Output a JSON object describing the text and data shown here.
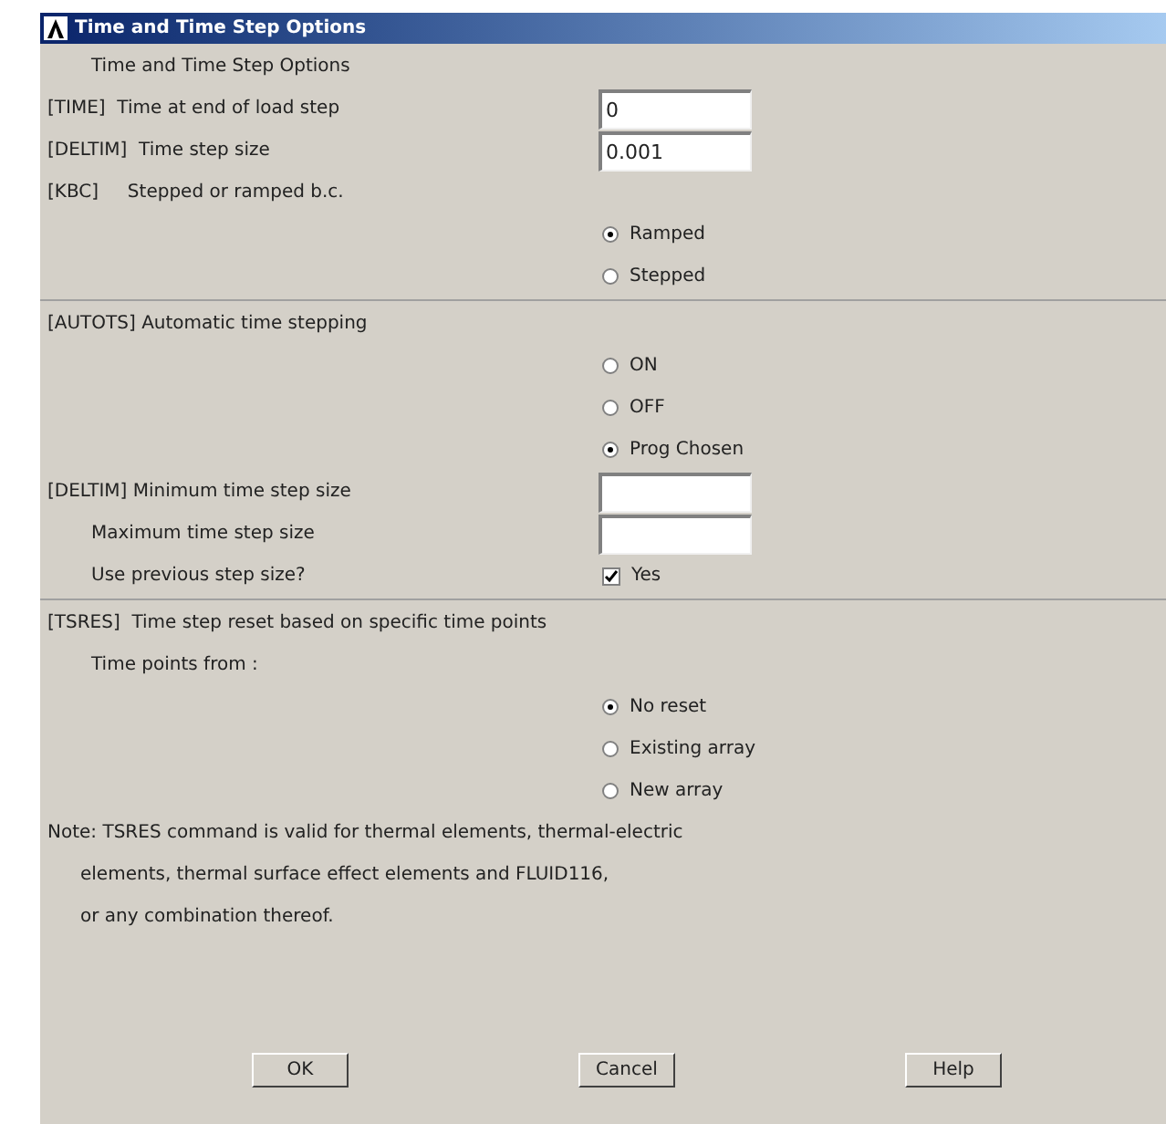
{
  "window": {
    "title": "Time and Time Step Options"
  },
  "sections": [
    {
      "rows": [
        {
          "kind": "heading",
          "label": "Time and Time Step Options",
          "indented": true
        },
        {
          "kind": "field",
          "label": "[TIME]  Time at end of load step",
          "value": "0",
          "indented": false
        },
        {
          "kind": "field",
          "label": "[DELTIM]  Time step size",
          "value": "0.001",
          "indented": false
        },
        {
          "kind": "heading",
          "label": "[KBC]     Stepped or ramped b.c.",
          "indented": false
        },
        {
          "kind": "radio",
          "label": "Ramped",
          "selected": true
        },
        {
          "kind": "radio",
          "label": "Stepped",
          "selected": false
        }
      ]
    },
    {
      "rows": [
        {
          "kind": "heading",
          "label": "[AUTOTS] Automatic time stepping",
          "indented": false
        },
        {
          "kind": "radio",
          "label": "ON",
          "selected": false
        },
        {
          "kind": "radio",
          "label": "OFF",
          "selected": false
        },
        {
          "kind": "radio",
          "label": "Prog Chosen",
          "selected": true
        },
        {
          "kind": "field",
          "label": "[DELTIM] Minimum time step size",
          "value": "",
          "indented": false
        },
        {
          "kind": "field",
          "label": "Maximum time step size",
          "value": "",
          "indented": true
        },
        {
          "kind": "checkbox",
          "label": "Use previous step size?",
          "option": "Yes",
          "checked": true,
          "indented": true
        }
      ]
    },
    {
      "rows": [
        {
          "kind": "heading",
          "label": "[TSRES]  Time step reset based on specific time points",
          "indented": false
        },
        {
          "kind": "heading",
          "label": "Time points from :",
          "indented": true
        },
        {
          "kind": "radio",
          "label": "No reset",
          "selected": true
        },
        {
          "kind": "radio",
          "label": "Existing array",
          "selected": false
        },
        {
          "kind": "radio",
          "label": "New array",
          "selected": false
        },
        {
          "kind": "note",
          "lines": [
            "Note: TSRES command is valid for thermal elements, thermal-electric",
            "elements, thermal surface effect elements and FLUID116,",
            "or any combination thereof."
          ]
        }
      ]
    }
  ],
  "buttons": [
    "OK",
    "Cancel",
    "Help"
  ]
}
